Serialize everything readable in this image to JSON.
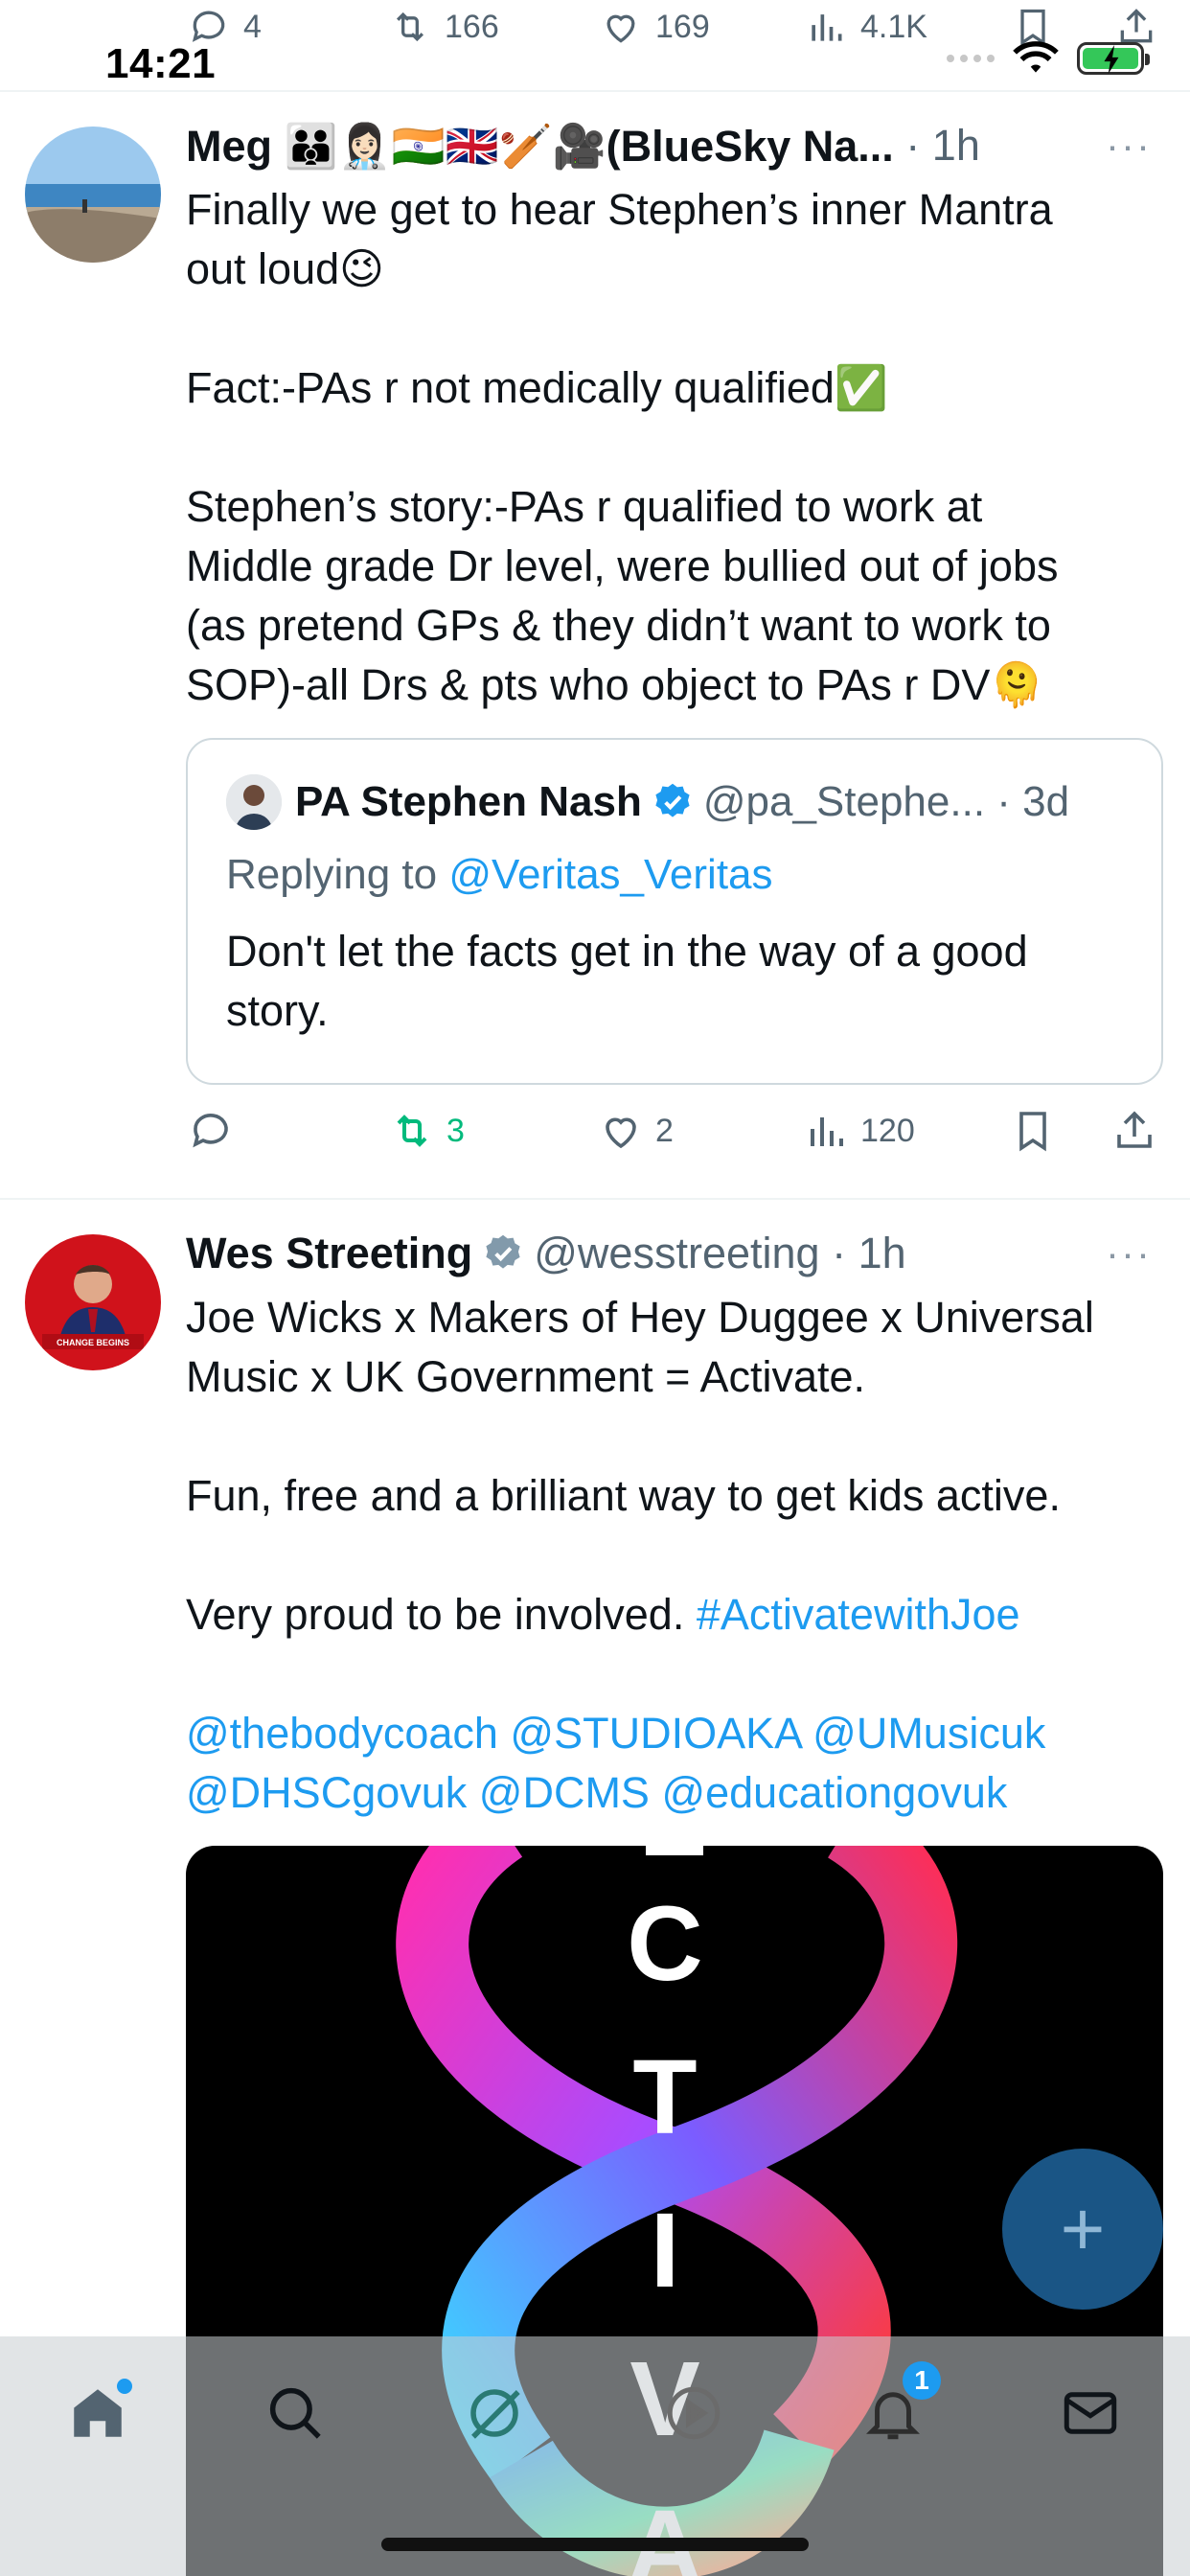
{
  "status_bar": {
    "time": "14:21"
  },
  "prev_tweet_actions": {
    "replies": "4",
    "reposts": "166",
    "likes": "169",
    "views": "4.1K"
  },
  "tweets": [
    {
      "name": "Meg 👪👩🏻‍⚕️🇮🇳🇬🇧🏏🎥(BlueSky Na...",
      "time": "1h",
      "more_label": "···",
      "text_lines": [
        "Finally we get to hear Stephen’s inner Mantra",
        "out loud😉",
        "Fact:-PAs r not medically qualified✅",
        "Stephen’s story:-PAs r qualified to work at",
        "Middle grade Dr level, were bullied out of jobs",
        "(as pretend GPs & they didn’t want to work to",
        "SOP)-all Drs & pts who object to PAs r DV🫠"
      ],
      "quote": {
        "name": "PA Stephen Nash",
        "handle": "@pa_Stephe...",
        "time": "3d",
        "replying_prefix": "Replying to ",
        "replying_to": "@Veritas_Veritas",
        "text_lines": [
          "Don't let the facts get in the way of a good",
          "story."
        ]
      },
      "actions": {
        "replies": "",
        "reposts": "3",
        "likes": "2",
        "views": "120"
      }
    },
    {
      "name": "Wes Streeting",
      "handle": "@wesstreeting",
      "time": "1h",
      "more_label": "···",
      "avatar_caption": "CHANGE BEGINS",
      "text_lines": [
        "Joe Wicks x Makers of Hey Duggee x Universal",
        "Music x UK Government = Activate.",
        "Fun, free and a brilliant way to get kids active.",
        "Very proud to be involved. "
      ],
      "hashtag": "#ActivatewithJoe",
      "mentions_line1": "@thebodycoach @STUDIOAKA @UMusicuk",
      "mentions_line2": "@DHSCgovuk @DCMS @educationgovuk",
      "media_letters": [
        "C",
        "T",
        "I",
        "V",
        "A"
      ]
    }
  ],
  "fab": {
    "label": "+"
  },
  "bottom_nav": {
    "notifications_badge": "1"
  },
  "colors": {
    "link": "#1d9bf0",
    "repost_active": "#00ba7c",
    "fab": "#1a5585"
  }
}
